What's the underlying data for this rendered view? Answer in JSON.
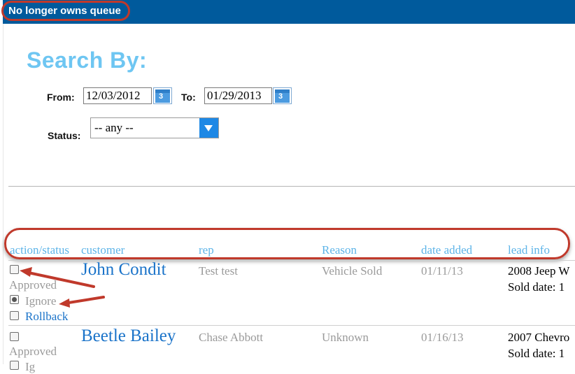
{
  "window": {
    "title": "No longer owns queue"
  },
  "search": {
    "title": "Search By:",
    "from_label": "From:",
    "from_value": "12/03/2012",
    "to_label": "To:",
    "to_value": "01/29/2013",
    "calendar_day": "3",
    "status_label": "Status:",
    "status_value": "-- any --"
  },
  "table": {
    "headers": [
      "action/status",
      "customer",
      "rep",
      "Reason",
      "date added",
      "lead info"
    ],
    "rows": [
      {
        "options": [
          "Approved",
          "Ignore",
          "Rollback"
        ],
        "customer": "John Condit",
        "rep": "Test test",
        "reason": "Vehicle Sold",
        "date_added": "01/11/13",
        "lead_vehicle": "2008 Jeep W",
        "lead_sold": "Sold date: 1"
      },
      {
        "options": [
          "Approved",
          "Ig"
        ],
        "customer": "Beetle Bailey",
        "rep": "Chase Abbott",
        "reason": "Unknown",
        "date_added": "01/16/13",
        "lead_vehicle": "2007 Chevro",
        "lead_sold": "Sold date: 1"
      }
    ]
  },
  "colors": {
    "titlebar": "#005a9c",
    "annotation": "#c0392b",
    "heading_blue": "#6ec6f2",
    "link_blue": "#1a73c9"
  }
}
